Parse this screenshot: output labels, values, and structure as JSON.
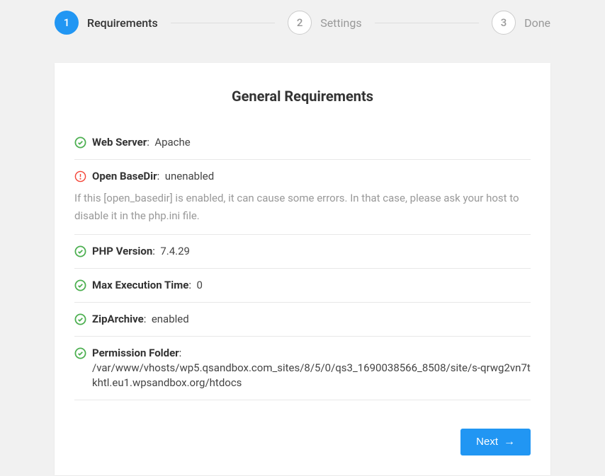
{
  "stepper": {
    "steps": [
      {
        "num": "1",
        "label": "Requirements",
        "active": true
      },
      {
        "num": "2",
        "label": "Settings",
        "active": false
      },
      {
        "num": "3",
        "label": "Done",
        "active": false
      }
    ]
  },
  "title": "General Requirements",
  "requirements": [
    {
      "status": "ok",
      "label": "Web Server",
      "value": "Apache",
      "desc": null
    },
    {
      "status": "warn",
      "label": "Open BaseDir",
      "value": "unenabled",
      "desc": "If this [open_basedir] is enabled, it can cause some errors. In that case, please ask your host to disable it in the php.ini file."
    },
    {
      "status": "ok",
      "label": "PHP Version",
      "value": "7.4.29",
      "desc": null
    },
    {
      "status": "ok",
      "label": "Max Execution Time",
      "value": "0",
      "desc": null
    },
    {
      "status": "ok",
      "label": "ZipArchive",
      "value": "enabled",
      "desc": null
    },
    {
      "status": "ok",
      "label": "Permission Folder",
      "value": "/var/www/vhosts/wp5.qsandbox.com_sites/8/5/0/qs3_1690038566_8508/site/s-qrwg2vn7tkhtl.eu1.wpsandbox.org/htdocs",
      "desc": null,
      "multiline": true
    }
  ],
  "nextButton": "Next"
}
